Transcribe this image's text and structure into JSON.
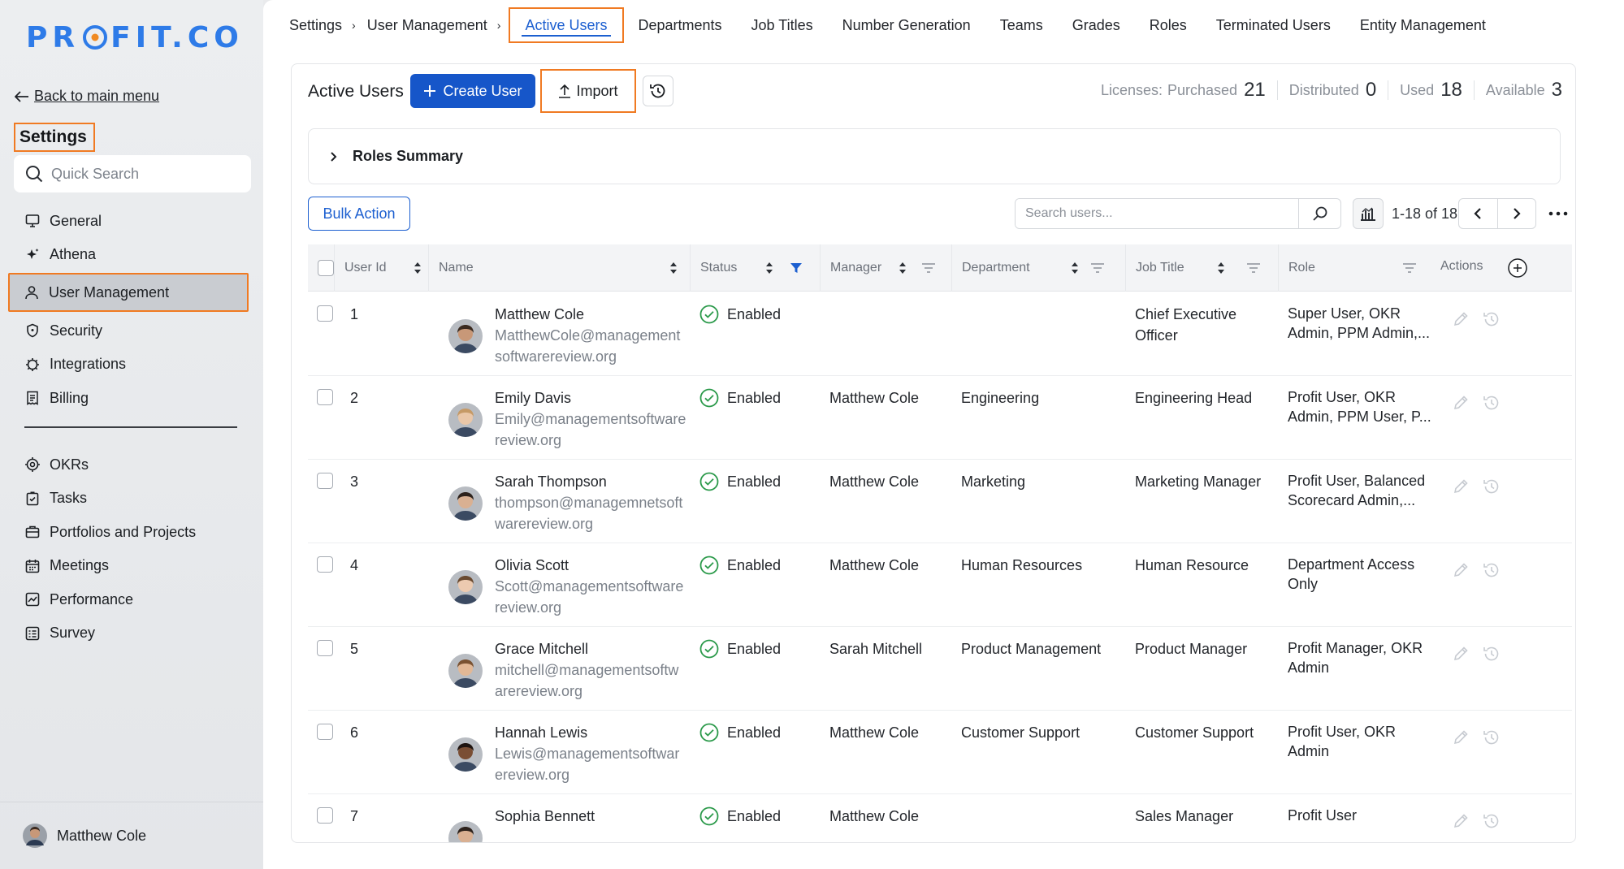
{
  "brand": {
    "logo_pre": "PR",
    "logo_post": "FIT.CO"
  },
  "sidebar": {
    "back_label": "Back to main menu",
    "section_title": "Settings",
    "search_placeholder": "Quick Search",
    "items": [
      {
        "label": "General",
        "icon": "monitor-icon"
      },
      {
        "label": "Athena",
        "icon": "sparkle-icon"
      },
      {
        "label": "User Management",
        "icon": "user-icon"
      },
      {
        "label": "Security",
        "icon": "shield-icon"
      },
      {
        "label": "Integrations",
        "icon": "gear-icon"
      },
      {
        "label": "Billing",
        "icon": "receipt-icon"
      }
    ],
    "apps": [
      {
        "label": "OKRs",
        "icon": "target-icon"
      },
      {
        "label": "Tasks",
        "icon": "clipboard-check-icon"
      },
      {
        "label": "Portfolios and Projects",
        "icon": "briefcase-icon"
      },
      {
        "label": "Meetings",
        "icon": "calendar-icon"
      },
      {
        "label": "Performance",
        "icon": "chart-icon"
      },
      {
        "label": "Survey",
        "icon": "survey-icon"
      }
    ],
    "current_user": "Matthew Cole"
  },
  "topnav": {
    "breadcrumbs": [
      "Settings",
      "User Management"
    ],
    "tabs": [
      "Active Users",
      "Departments",
      "Job Titles",
      "Number Generation",
      "Teams",
      "Grades",
      "Roles",
      "Terminated Users",
      "Entity Management"
    ]
  },
  "toolbar": {
    "title": "Active Users",
    "create_label": "Create User",
    "import_label": "Import",
    "licenses_label": "Licenses:",
    "purchased_label": "Purchased",
    "purchased": "21",
    "distributed_label": "Distributed",
    "distributed": "0",
    "used_label": "Used",
    "used": "18",
    "available_label": "Available",
    "available": "3"
  },
  "roles_summary_label": "Roles Summary",
  "bulk_action_label": "Bulk Action",
  "search": {
    "placeholder": "Search users..."
  },
  "pagination": {
    "text": "1-18 of 18"
  },
  "table": {
    "columns": [
      "User Id",
      "Name",
      "Status",
      "Manager",
      "Department",
      "Job Title",
      "Role",
      "Actions"
    ],
    "rows": [
      {
        "id": "1",
        "name": "Matthew Cole",
        "email": [
          "MatthewCole@management",
          "softwarereview.org",
          ""
        ],
        "status": "Enabled",
        "manager": "",
        "department": "",
        "job": [
          "Chief Executive",
          "Officer"
        ],
        "role": [
          "Super User, OKR",
          "Admin, PPM Admin,..."
        ],
        "skin": "#c89878",
        "hair": "#3a2a20"
      },
      {
        "id": "2",
        "name": "Emily Davis",
        "email": [
          "Emily@managementsoftware",
          "review.org",
          ""
        ],
        "status": "Enabled",
        "manager": "Matthew Cole",
        "department": "Engineering",
        "job": [
          "Engineering Head",
          ""
        ],
        "role": [
          "Profit User, OKR",
          "Admin, PPM User, P..."
        ],
        "skin": "#eac7a8",
        "hair": "#c69a66"
      },
      {
        "id": "3",
        "name": "Sarah Thompson",
        "email": [
          "thompson@managemnetsoft",
          "warereview.org",
          ""
        ],
        "status": "Enabled",
        "manager": "Matthew Cole",
        "department": "Marketing",
        "job": [
          "Marketing Manager",
          ""
        ],
        "role": [
          "Profit User, Balanced",
          "Scorecard Admin,..."
        ],
        "skin": "#d9b092",
        "hair": "#2d221c"
      },
      {
        "id": "4",
        "name": "Olivia Scott",
        "email": [
          "Scott@managementsoftware",
          "review.org",
          ""
        ],
        "status": "Enabled",
        "manager": "Matthew Cole",
        "department": "Human Resources",
        "job": [
          "Human Resource",
          ""
        ],
        "role": [
          "Department Access",
          "Only"
        ],
        "skin": "#eccab0",
        "hair": "#6a4a30"
      },
      {
        "id": "5",
        "name": "Grace Mitchell",
        "email": [
          "mitchell@managementsoftw",
          "arereview.org",
          ""
        ],
        "status": "Enabled",
        "manager": "Sarah Mitchell",
        "department": "Product Management",
        "job": [
          "Product Manager",
          ""
        ],
        "role": [
          "Profit Manager, OKR",
          "Admin"
        ],
        "skin": "#e2b896",
        "hair": "#7a5232"
      },
      {
        "id": "6",
        "name": "Hannah Lewis",
        "email": [
          "Lewis@managementsoftwar",
          "ereview.org",
          ""
        ],
        "status": "Enabled",
        "manager": "Matthew Cole",
        "department": "Customer Support",
        "job": [
          "Customer Support",
          ""
        ],
        "role": [
          "Profit User, OKR",
          "Admin"
        ],
        "skin": "#7a4e34",
        "hair": "#1e1410"
      },
      {
        "id": "7",
        "name": "Sophia Bennett",
        "email": [
          "",
          "",
          ""
        ],
        "status": "Enabled",
        "manager": "Matthew Cole",
        "department": "",
        "job": [
          "Sales Manager",
          ""
        ],
        "role": [
          "Profit User",
          ""
        ],
        "skin": "#d9b092",
        "hair": "#2d221c"
      }
    ]
  },
  "colors": {
    "brand_blue": "#2e7be8",
    "accent_orange": "#f07a22",
    "primary": "#1656c9",
    "success": "#2c9a4b"
  }
}
